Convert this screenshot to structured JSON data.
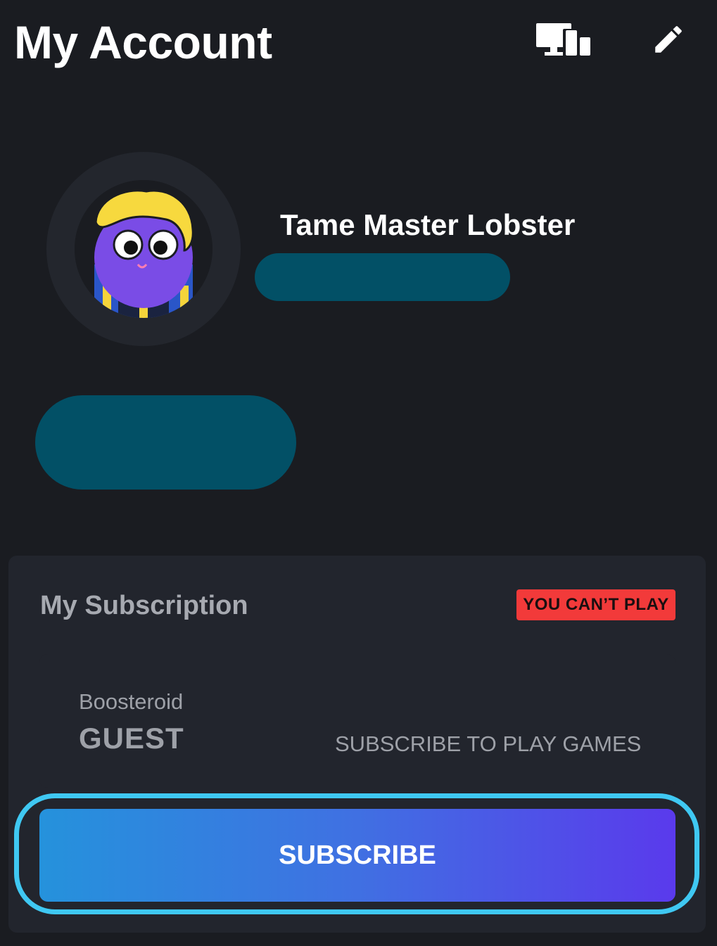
{
  "header": {
    "title": "My Account",
    "devices_icon": "devices-icon",
    "edit_icon": "pencil-icon"
  },
  "profile": {
    "username": "Tame Master Lobster",
    "avatar": "avatar-character"
  },
  "subscription": {
    "title": "My Subscription",
    "status_badge": "YOU CAN’T PLAY",
    "brand": "Boosteroid",
    "plan": "GUEST",
    "note": "SUBSCRIBE TO PLAY GAMES",
    "subscribe_label": "SUBSCRIBE"
  },
  "colors": {
    "background": "#1a1c21",
    "card": "#22252d",
    "redaction": "#025066",
    "badge": "#f23a3a",
    "highlight": "#3fc8f2",
    "button_gradient_start": "#2592dc",
    "button_gradient_end": "#5a3aec"
  }
}
